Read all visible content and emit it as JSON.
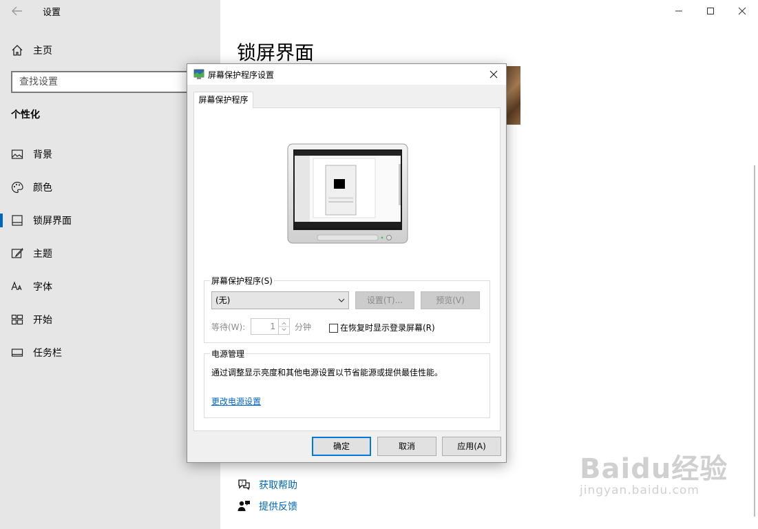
{
  "window": {
    "app_title": "设置",
    "controls": {
      "minimize": "—",
      "maximize": "☐",
      "close": "✕"
    }
  },
  "nav": {
    "home": "主页",
    "search_placeholder": "查找设置",
    "section": "个性化",
    "items": [
      {
        "label": "背景",
        "icon": "image-icon"
      },
      {
        "label": "颜色",
        "icon": "palette-icon"
      },
      {
        "label": "锁屏界面",
        "icon": "lock-screen-icon",
        "active": true
      },
      {
        "label": "主题",
        "icon": "brush-icon"
      },
      {
        "label": "字体",
        "icon": "font-icon"
      },
      {
        "label": "开始",
        "icon": "start-icon"
      },
      {
        "label": "任务栏",
        "icon": "taskbar-icon"
      }
    ]
  },
  "main": {
    "title": "锁屏界面",
    "help_links": [
      {
        "label": "获取帮助",
        "icon": "help-chat-icon"
      },
      {
        "label": "提供反馈",
        "icon": "feedback-icon"
      }
    ]
  },
  "dialog": {
    "title": "屏幕保护程序设置",
    "tab": "屏幕保护程序",
    "screensaver": {
      "group_label": "屏幕保护程序(S)",
      "selected": "(无)",
      "settings_button": "设置(T)...",
      "preview_button": "预览(V)",
      "wait_label": "等待(W):",
      "wait_value": "1",
      "minutes_label": "分钟",
      "resume_checkbox": "在恢复时显示登录屏幕(R)",
      "resume_checked": false
    },
    "power": {
      "group_label": "电源管理",
      "description": "通过调整显示亮度和其他电源设置以节省能源或提供最佳性能。",
      "link": "更改电源设置"
    },
    "buttons": {
      "ok": "确定",
      "cancel": "取消",
      "apply": "应用(A)"
    }
  },
  "watermark": {
    "brand": "Baidu经验",
    "url": "jingyan.baidu.com"
  },
  "colors": {
    "accent": "#0067b8",
    "link": "#0066cc",
    "nav_bg": "#e6e6e6",
    "dialog_bg": "#f0f0f0"
  }
}
